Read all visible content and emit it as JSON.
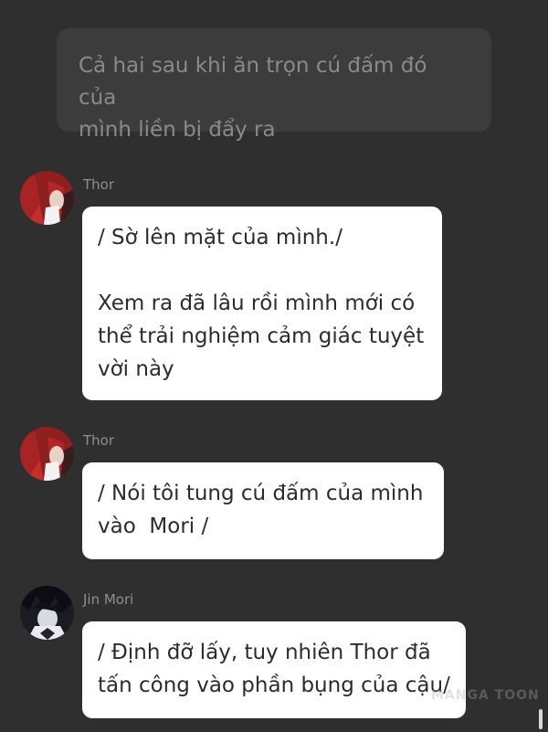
{
  "narration": {
    "lines": [
      "Cả hai sau khi ăn trọn cú đấm đó của",
      "mình liền bị đẩy ra"
    ]
  },
  "messages": [
    {
      "sender": "Thor",
      "avatar_icon": "red-hair-character-avatar",
      "lines": [
        "/ Sờ lên mặt của mình./",
        "",
        "Xem ra đã lâu rồi mình mới có",
        "thể trải nghiệm cảm giác tuyệt",
        "vời này"
      ]
    },
    {
      "sender": "Thor",
      "avatar_icon": "red-hair-character-avatar",
      "lines": [
        "/ Nói tôi tung cú đấm của mình",
        "vào  Mori /"
      ]
    },
    {
      "sender": "Jin Mori",
      "avatar_icon": "dark-hair-character-avatar",
      "lines": [
        "/ Định đỡ lấy, tuy nhiên Thor đã",
        "tấn công vào phần bụng của cậu/"
      ]
    }
  ],
  "watermark": "MANGA TOON",
  "colors": {
    "background": "#2f2f2f",
    "narration_bg": "#3c3c3c",
    "bubble_bg": "#ffffff",
    "narration_text": "#8a8a8a",
    "sender_text": "#8f8f8f"
  }
}
